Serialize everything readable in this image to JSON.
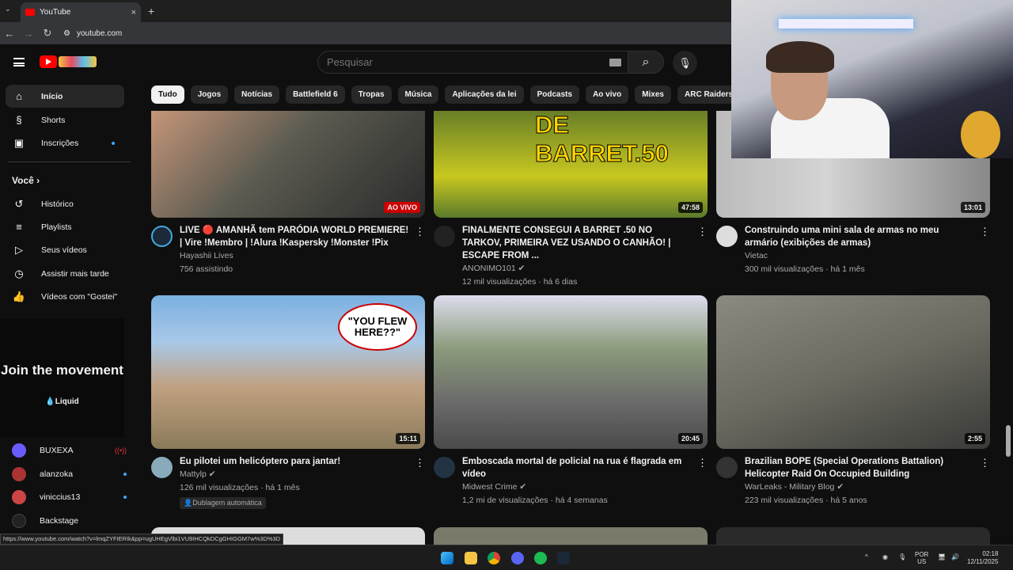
{
  "browser": {
    "tab_title": "YouTube",
    "tab_close": "×",
    "new_tab": "+",
    "url": "youtube.com",
    "status_url": "https://www.youtube.com/watch?v=lmqZYFIERIk&pp=ugUHEgVlbi1VU9IHCQkDCgGHIGGM7w%3D%3D"
  },
  "header": {
    "search_placeholder": "Pesquisar"
  },
  "chips": [
    "Tudo",
    "Jogos",
    "Notícias",
    "Battlefield 6",
    "Tropas",
    "Música",
    "Aplicações da lei",
    "Podcasts",
    "Ao vivo",
    "Mixes",
    "ARC Raiders"
  ],
  "sidebar": {
    "items": [
      {
        "label": "Início",
        "icon": "home-icon"
      },
      {
        "label": "Shorts",
        "icon": "shorts-icon"
      },
      {
        "label": "Inscrições",
        "icon": "subscriptions-icon"
      }
    ],
    "you_label": "Você",
    "you_items": [
      {
        "label": "Histórico",
        "icon": "history-icon"
      },
      {
        "label": "Playlists",
        "icon": "playlists-icon"
      },
      {
        "label": "Seus vídeos",
        "icon": "your-videos-icon"
      },
      {
        "label": "Assistir mais tarde",
        "icon": "watch-later-icon"
      },
      {
        "label": "Vídeos com \"Gostei\"",
        "icon": "liked-icon"
      }
    ],
    "ad_headline": "Join the movement",
    "ad_brand": "Liquid",
    "subscriptions": [
      {
        "name": "BUXEXA",
        "live": true
      },
      {
        "name": "alanzoka",
        "dot": true
      },
      {
        "name": "viniccius13",
        "dot": true
      },
      {
        "name": "Backstage",
        "dot": false
      }
    ]
  },
  "videos": [
    {
      "title": "LIVE 🔴 AMANHÃ tem PARÓDIA WORLD PREMIERE! | Vire !Membro | !Alura !Kaspersky !Monster !Pix",
      "channel": "Hayashii Lives",
      "stats": "756 assistindo",
      "badge": "AO VIVO",
      "live": true
    },
    {
      "title": "FINALMENTE CONSEGUI A BARRET .50 NO TARKOV, PRIMEIRA VEZ USANDO O CANHÃO! | ESCAPE FROM ...",
      "channel": "ANONIMO101",
      "verified": true,
      "stats": "12 mil visualizações · há 6 dias",
      "badge": "47:58",
      "thumb_text": "DE BARRET.50"
    },
    {
      "title": "Construindo uma mini sala de armas no meu armário (exibições de armas)",
      "channel": "Vietac",
      "stats": "300 mil visualizações · há 1 mês",
      "badge": "13:01"
    },
    {
      "title": "Eu pilotei um helicóptero para jantar!",
      "channel": "Mattylp",
      "verified": true,
      "stats": "126 mil visualizações · há 1 mês",
      "badge": "15:11",
      "thumb_text": "\"YOU FLEW HERE??\"",
      "tag": "Dublagem automática"
    },
    {
      "title": "Emboscada mortal de policial na rua é flagrada em vídeo",
      "channel": "Midwest Crime",
      "verified": true,
      "stats": "1,2 mi de visualizações · há 4 semanas",
      "badge": "20:45"
    },
    {
      "title": "Brazilian BOPE (Special Operations Battalion) Helicopter Raid On Occupied Building",
      "channel": "WarLeaks - Military Blog",
      "verified": true,
      "stats": "223 mil visualizações · há 5 anos",
      "badge": "2:55"
    }
  ],
  "taskbar": {
    "lang_top": "POR",
    "lang_bottom": "US",
    "time": "02:18",
    "date": "12/11/2025"
  }
}
